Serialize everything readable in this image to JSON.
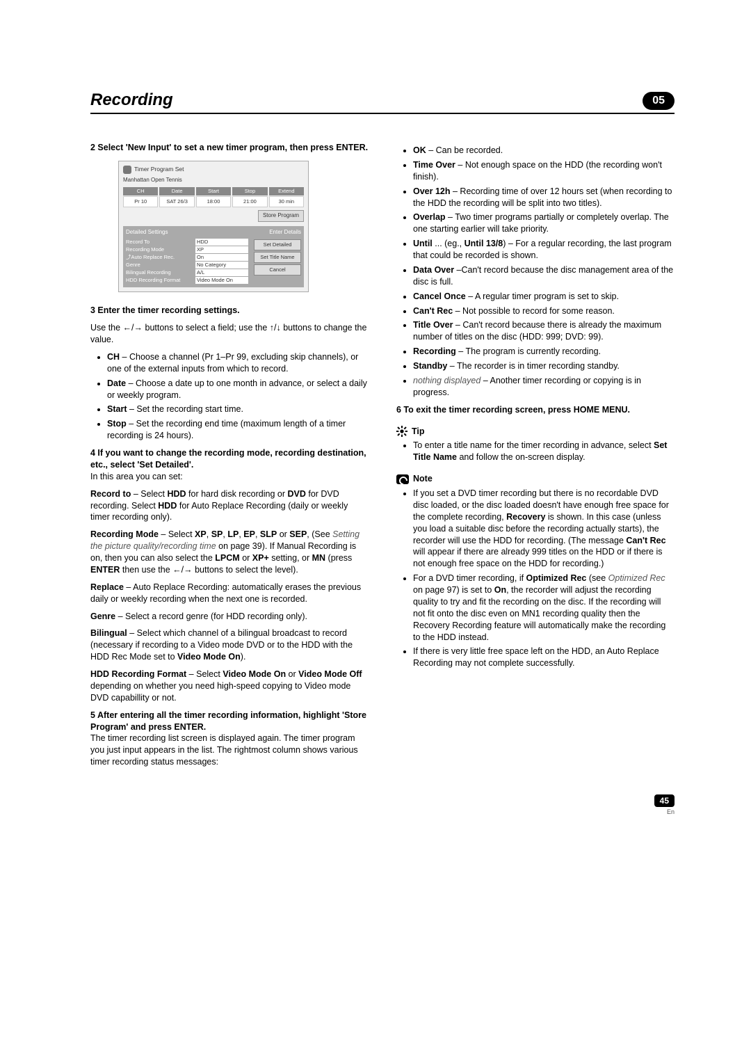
{
  "header": {
    "title": "Recording",
    "chapter": "05"
  },
  "left": {
    "step2": "2   Select 'New Input' to set a new timer program, then press ENTER.",
    "ui": {
      "window_title": "Timer Program Set",
      "program_name": "Manhattan Open Tennis",
      "head": [
        "CH",
        "Date",
        "Start",
        "Stop",
        "Extend"
      ],
      "vals": [
        "Pr 10",
        "SAT 26/3",
        "18:00",
        "21:00",
        "30 min"
      ],
      "store": "Store Program",
      "detail_head_left": "Detailed Settings",
      "detail_head_right": "Enter Details",
      "rows": [
        {
          "lbl": "Record To",
          "val": "HDD"
        },
        {
          "lbl": "Recording Mode",
          "val": "XP"
        },
        {
          "lbl": "⤴Auto Replace Rec.",
          "val": "On"
        },
        {
          "lbl": "Genre",
          "val": "No Category"
        },
        {
          "lbl": "Bilingual Recording",
          "val": "A/L"
        },
        {
          "lbl": "HDD Recording Format",
          "val": "Video Mode On"
        }
      ],
      "side_btns": [
        "Set Detailed",
        "Set Title Name",
        "Cancel"
      ]
    },
    "step3_head": "3   Enter the timer recording settings.",
    "step3_line": "Use the ←/→ buttons to select a field; use the ↑/↓ buttons to change the value.",
    "step3_bullets": [
      {
        "b": "CH",
        "t": " – Choose a channel (Pr 1–Pr 99, excluding skip channels), or one of the external inputs from which to record."
      },
      {
        "b": "Date",
        "t": " – Choose a date up to one month in advance, or select a daily or weekly program."
      },
      {
        "b": "Start",
        "t": " – Set the recording start time."
      },
      {
        "b": "Stop",
        "t": " – Set the recording end time (maximum length of a timer recording is 24 hours)."
      }
    ],
    "step4_head": "4   If you want to change the recording mode, recording destination, etc., select 'Set Detailed'.",
    "step4_sub": "In this area you can set:",
    "record_to": "Record to – Select HDD for hard disk recording or DVD for DVD recording. Select HDD  for Auto Replace Recording (daily or weekly timer recording only).",
    "rec_mode_1": "Recording Mode – Select XP, SP, LP, EP, SLP or SEP, (See ",
    "rec_mode_it": "Setting the picture quality/recording time",
    "rec_mode_2": " on page 39). If Manual Recording is on, then you can also select the LPCM or XP+ setting, or MN (press ENTER then use the ←/→ buttons to select the level).",
    "replace": "Replace – Auto Replace Recording: automatically erases the previous daily or weekly recording when the next one is recorded.",
    "genre": "Genre – Select a record genre (for HDD recording only).",
    "bilingual": "Bilingual – Select which channel of a bilingual broadcast to record (necessary if recording to a Video mode DVD or to the HDD with the HDD Rec Mode set to Video Mode On).",
    "hdd_rec": "HDD Recording Format – Select Video Mode On or Video Mode Off depending on whether you need high-speed copying to Video mode DVD capabillity or not.",
    "step5_head": "5   After entering all the timer recording information, highlight 'Store Program' and press ENTER.",
    "step5_body": "The timer recording list screen is displayed again. The timer program you just input appears in the list. The rightmost column shows various timer recording status messages:"
  },
  "right": {
    "status": [
      {
        "b": "OK",
        "t": " – Can be recorded."
      },
      {
        "b": "Time Over",
        "t": " – Not enough space on the HDD (the recording won't finish)."
      },
      {
        "b": "Over 12h",
        "t": "  – Recording time of over 12 hours set (when recording to the HDD the recording will be split into two titles)."
      },
      {
        "b": "Overlap",
        "t": " – Two timer programs partially or completely overlap. The one starting earlier will take priority."
      },
      {
        "b": "Until",
        "t": " ... (eg., Until 13/8) – For a regular recording, the last program that could be recorded is shown."
      },
      {
        "b": "Data Over",
        "t": " –Can't record because the disc management area of the disc is full."
      },
      {
        "b": "Cancel Once",
        "t": " – A regular timer program is set to skip."
      },
      {
        "b": "Can't Rec",
        "t": " – Not possible to record for some reason."
      },
      {
        "b": "Title Over",
        "t": " – Can't record because there is already the maximum number of titles on the disc (HDD: 999; DVD: 99)."
      },
      {
        "b": "Recording",
        "t": " – The program is currently recording."
      },
      {
        "b": "Standby",
        "t": " – The recorder is in timer recording standby."
      },
      {
        "bi": "nothing displayed",
        "t": " – Another timer recording or copying is in progress."
      }
    ],
    "step6": "6   To exit the timer recording screen, press HOME MENU.",
    "tip_label": "Tip",
    "tip_body": "To enter a title name for the timer recording in advance, select Set Title Name and follow the on-screen display.",
    "note_label": "Note",
    "note1a": "If you set a DVD timer recording but there is no recordable DVD disc loaded, or the disc loaded doesn't have enough free space for the complete recording, ",
    "note1b": "Recovery",
    "note1c": " is shown. In this case (unless you load a suitable disc before the recording actually starts), the recorder will use the HDD for recording. (The message ",
    "note1d": "Can't Rec",
    "note1e": " will appear if there are already 999 titles on the HDD or if there is not enough free space on the HDD for recording.)",
    "note2a": "For a DVD timer recording, if ",
    "note2b": "Optimized Rec",
    "note2c": " (see ",
    "note2it": "Optimized Rec",
    "note2d": " on page 97) is set to ",
    "note2e": "On",
    "note2f": ", the recorder will adjust the recording quality to try and fit the recording on the disc. If the recording will not fit onto the disc even on MN1 recording quality then the Recovery Recording feature will automatically make the recording to the HDD instead.",
    "note3": "If there is very little free space left on the HDD, an Auto Replace Recording may not complete successfully."
  },
  "footer": {
    "page": "45",
    "lang": "En"
  }
}
